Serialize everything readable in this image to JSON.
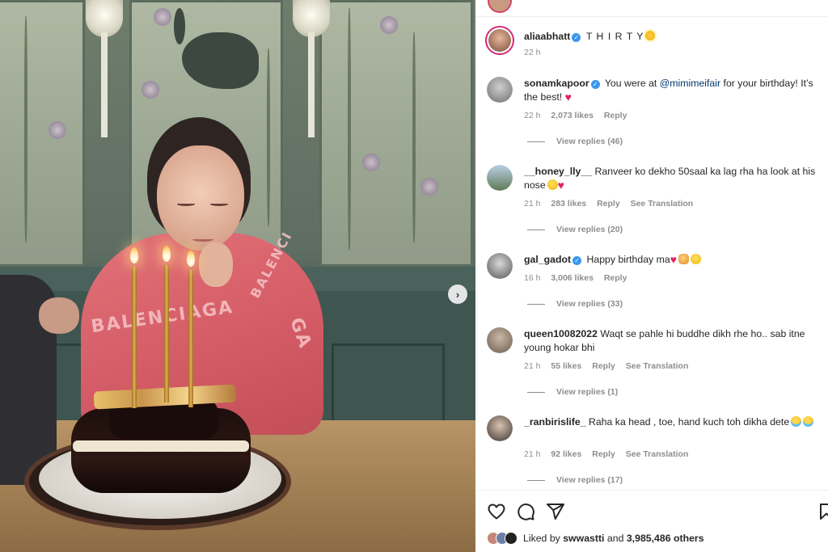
{
  "post": {
    "author": "aliaabhatt",
    "caption": "T H I R T Y",
    "time": "22 h"
  },
  "comments": [
    {
      "username": "sonamkapoor",
      "verified": true,
      "text_before": "You were at ",
      "mention": "@mimimeifair",
      "text_after": " for your birthday! It’s the best!",
      "time": "22 h",
      "likes": "2,073 likes",
      "reply": "Reply",
      "view_replies": "View replies (46)"
    },
    {
      "username": "__honey_lly__",
      "verified": false,
      "text": "Ranveer ko dekho 50saal ka lag rha ha look at his nose",
      "time": "21 h",
      "likes": "283 likes",
      "reply": "Reply",
      "translation": "See Translation",
      "view_replies": "View replies (20)"
    },
    {
      "username": "gal_gadot",
      "verified": true,
      "text": "Happy birthday ma",
      "time": "16 h",
      "likes": "3,006 likes",
      "reply": "Reply",
      "view_replies": "View replies (33)"
    },
    {
      "username": "queen10082022",
      "verified": false,
      "text": "Waqt se pahle hi buddhe dikh rhe ho.. sab itne young hokar bhi",
      "time": "21 h",
      "likes": "55 likes",
      "reply": "Reply",
      "translation": "See Translation",
      "view_replies": "View replies (1)"
    },
    {
      "username": "_ranbirislife_",
      "verified": false,
      "text": "Raha ka head , toe, hand kuch toh dikha dete",
      "time": "21 h",
      "likes": "92 likes",
      "reply": "Reply",
      "translation": "See Translation",
      "view_replies": "View replies (17)"
    }
  ],
  "likes_summary": {
    "prefix": "Liked by ",
    "user": "swwastti",
    "middle": " and ",
    "count": "3,985,486 others"
  },
  "photo": {
    "sweater_text_1": "BALENCIAGA",
    "sweater_text_2": "GA",
    "sweater_text_3": "BALENCI"
  },
  "icons": {
    "next": "chevron-right-icon",
    "like": "heart-icon",
    "comment": "comment-icon",
    "share": "paper-plane-icon",
    "save": "bookmark-icon",
    "verified": "verified-badge-icon"
  },
  "colors": {
    "verified": "#3897f0",
    "story_ring": "#d62976",
    "heart": "#e0245e",
    "mention": "#00376b",
    "muted": "#8e8e8e"
  }
}
